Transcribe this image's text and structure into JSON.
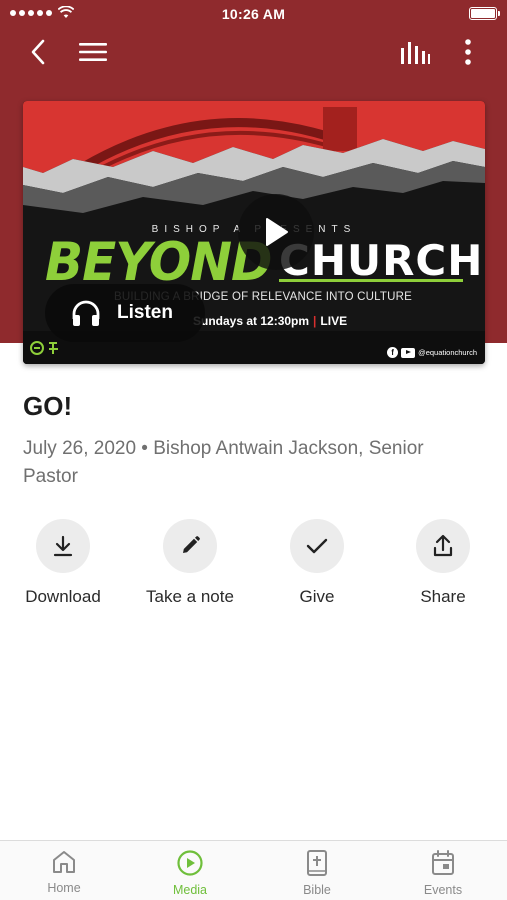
{
  "status_bar": {
    "time": "10:26 AM"
  },
  "colors": {
    "header": "#8f2a2d",
    "accent": "#6fbf3b",
    "action_bg": "#ececec"
  },
  "top_bar": {
    "back_icon": "chevron-left-icon",
    "menu_icon": "hamburger-icon",
    "equalizer_icon": "equalizer-icon",
    "more_icon": "more-vertical-icon"
  },
  "artwork": {
    "presents": "BISHOP A PRESENTS",
    "title_left": "BEYOND",
    "title_right": "CHURCH",
    "tagline": "BUILDING A BRIDGE OF RELEVANCE INTO CULTURE",
    "schedule_main": "Sundays at 12:30pm",
    "schedule_sep": "|",
    "schedule_live": "LIVE",
    "handle": "@equationchurch"
  },
  "player": {
    "play_icon": "play-icon",
    "listen_label": "Listen",
    "listen_icon": "headphones-icon"
  },
  "sermon": {
    "title": "GO!",
    "meta": "July 26, 2020 • Bishop Antwain Jackson, Senior Pastor"
  },
  "actions": [
    {
      "label": "Download",
      "icon": "download-icon"
    },
    {
      "label": "Take a note",
      "icon": "pencil-icon"
    },
    {
      "label": "Give",
      "icon": "checkmark-icon"
    },
    {
      "label": "Share",
      "icon": "share-icon"
    }
  ],
  "bottom_nav": [
    {
      "label": "Home",
      "icon": "home-icon",
      "active": false
    },
    {
      "label": "Media",
      "icon": "play-circle-icon",
      "active": true
    },
    {
      "label": "Bible",
      "icon": "bible-icon",
      "active": false
    },
    {
      "label": "Events",
      "icon": "calendar-icon",
      "active": false
    }
  ]
}
